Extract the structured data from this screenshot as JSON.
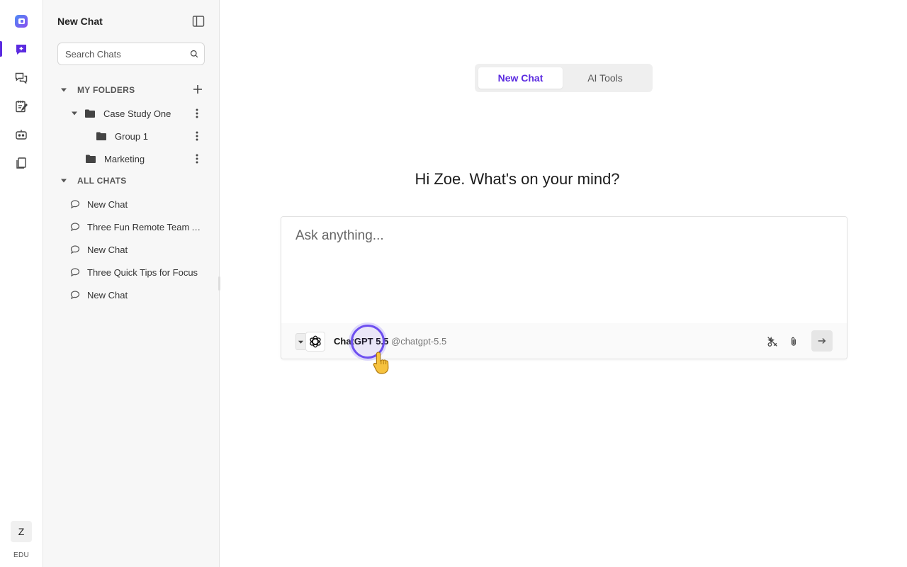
{
  "sidebar": {
    "title": "New Chat",
    "search_placeholder": "Search Chats",
    "folders_label": "MY FOLDERS",
    "folders": [
      {
        "label": "Case Study One"
      },
      {
        "label": "Group 1"
      },
      {
        "label": "Marketing"
      }
    ],
    "all_chats_label": "ALL CHATS",
    "chats": [
      {
        "label": "New Chat"
      },
      {
        "label": "Three Fun Remote Team Activities"
      },
      {
        "label": "New Chat"
      },
      {
        "label": "Three Quick Tips for Focus"
      },
      {
        "label": "New Chat"
      }
    ]
  },
  "rail": {
    "avatar_initial": "Z",
    "plan_label": "EDU",
    "accent": "#5b2be0"
  },
  "main": {
    "tabs": [
      {
        "label": "New Chat",
        "active": true
      },
      {
        "label": "AI Tools",
        "active": false
      }
    ],
    "greeting": "Hi Zoe. What's on your mind?",
    "composer_placeholder": "Ask anything...",
    "model": {
      "name": "ChatGPT 5.5",
      "handle": "@chatgpt-5.5",
      "icon": "openai-logo-icon"
    }
  }
}
